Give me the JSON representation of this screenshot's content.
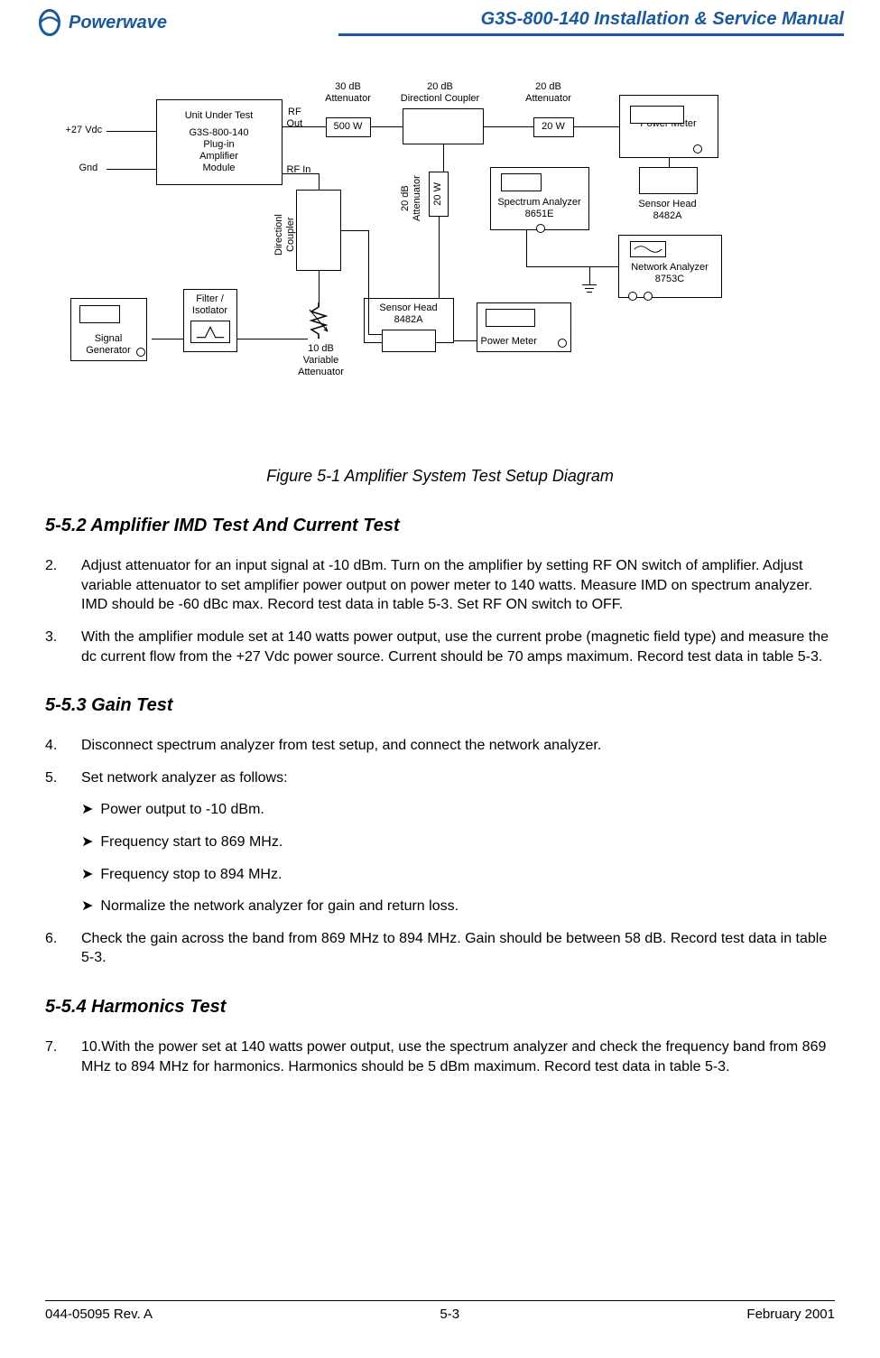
{
  "header": {
    "brand": "Powerwave",
    "doc_title": "G3S-800-140 Installation & Service Manual"
  },
  "figure": {
    "caption": "Figure 5-1   Amplifier System Test Setup Diagram",
    "labels": {
      "vdc": "+27 Vdc",
      "gnd": "Gnd",
      "uut1": "Unit Under Test",
      "uut2": "G3S-800-140",
      "uut3": "Plug-in",
      "uut4": "Amplifier",
      "uut5": "Module",
      "rf_out": "RF\nOut",
      "rf_in": "RF In",
      "att30": "30 dB\nAttenuator",
      "w500": "500 W",
      "dir_coupler_h": "20 dB\nDirectionl Coupler",
      "att20a": "20 dB\nAttenuator",
      "w20a": "20 W",
      "power_meter": "Power Meter",
      "sensor_head_r": "Sensor Head\n8482A",
      "spectrum": "Spectrum Analyzer\n8651E",
      "network": "Network Analyzer\n8753C",
      "w20b": "20 W",
      "att20b": "20 dB\nAttenuator",
      "dir_coupler_v": "Directionl\nCoupler",
      "var_att": "10 dB\nVariable\nAttenuator",
      "filter": "Filter /\nIsotlator",
      "sig_gen": "Signal\nGenerator",
      "sensor_head_l": "Sensor Head\n8482A",
      "power_meter_l": "Power Meter"
    }
  },
  "sections": {
    "s552_title": "5-5.2   Amplifier IMD Test And Current Test",
    "step2_num": "2.",
    "step2": "Adjust attenuator for an input signal at -10 dBm.  Turn on the amplifier by setting RF ON switch of amplifier. Adjust variable attenuator to set amplifier power output on power meter to 140 watts.  Measure IMD on spectrum analyzer.  IMD should be -60 dBc max.  Record test data in table 5-3.  Set RF ON switch to OFF.",
    "step3_num": "3.",
    "step3": "With the amplifier module set at 140 watts power output, use the current probe (magnetic field type) and measure the dc current flow from the +27 Vdc power source.  Current should be 70 amps maximum.  Record test data in table 5-3.",
    "s553_title": "5-5.3   Gain Test",
    "step4_num": "4.",
    "step4": "Disconnect spectrum analyzer from test setup, and connect the network analyzer.",
    "step5_num": "5.",
    "step5": "Set network analyzer as follows:",
    "sub1": "Power output to -10 dBm.",
    "sub2": "Frequency start to 869 MHz.",
    "sub3": "Frequency stop to 894 MHz.",
    "sub4": "Normalize the network analyzer for gain and return loss.",
    "step6_num": "6.",
    "step6": "Check the gain across the band from 869 MHz to 894 MHz.  Gain should be between 58 dB.  Record test data in table 5-3.",
    "s554_title": "5-5.4   Harmonics Test",
    "step7_num": "7.",
    "step7": "10.With the power set at 140 watts power output, use the spectrum analyzer and check the frequency band from 869 MHz to 894 MHz for harmonics.  Harmonics should be 5 dBm maximum.  Record test data in table 5-3."
  },
  "footer": {
    "left": "044-05095 Rev. A",
    "center": "5-3",
    "right": "February 2001"
  }
}
